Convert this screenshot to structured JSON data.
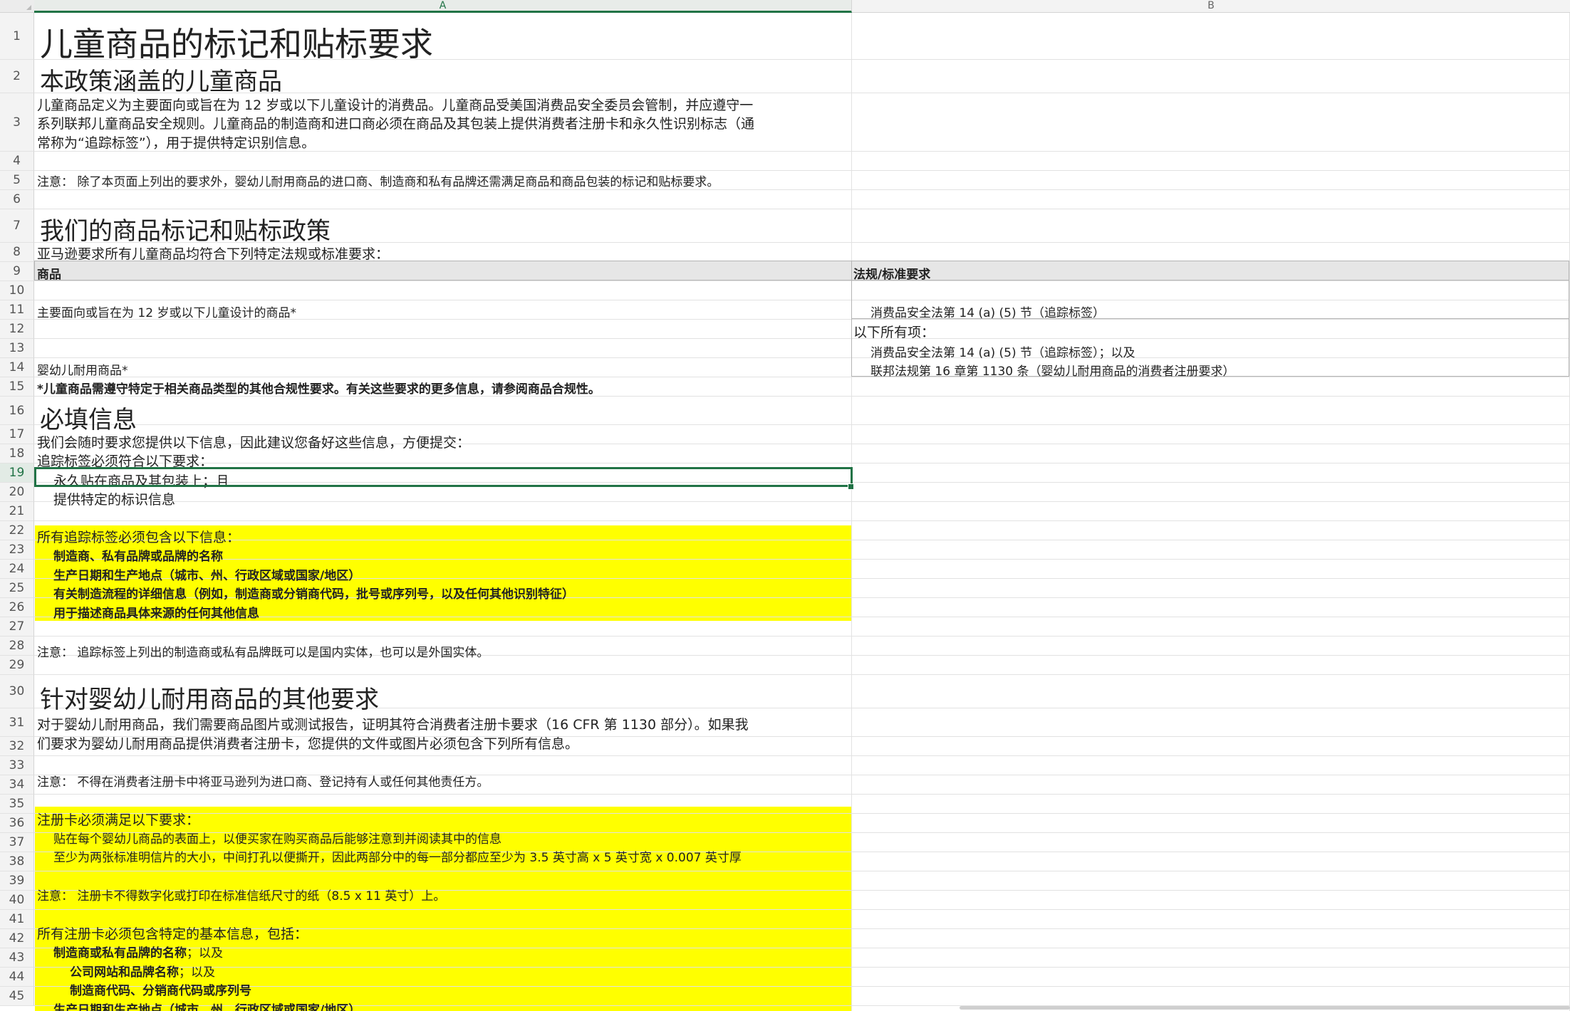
{
  "columns": [
    "A",
    "B"
  ],
  "rows": [
    "1",
    "2",
    "3",
    "4",
    "5",
    "6",
    "7",
    "8",
    "9",
    "10",
    "11",
    "12",
    "13",
    "14",
    "15",
    "16",
    "17",
    "18",
    "19",
    "20",
    "21",
    "22",
    "23",
    "24",
    "25",
    "26",
    "27",
    "28",
    "29",
    "30",
    "31",
    "32",
    "33",
    "34",
    "35",
    "36",
    "37",
    "38",
    "39",
    "40",
    "41",
    "42",
    "43",
    "44",
    "45"
  ],
  "selected_row": "19",
  "title": "儿童商品的标记和贴标要求",
  "section1": {
    "heading": "本政策涵盖的儿童商品",
    "para_line1": "儿童商品定义为主要面向或旨在为 12 岁或以下儿童设计的消费品。儿童商品受美国消费品安全委员会管制，并应遵守一",
    "para_line2": "系列联邦儿童商品安全规则。儿童商品的制造商和进口商必须在商品及其包装上提供消费者注册卡和永久性识别标志（通",
    "para_line3": "常称为“追踪标签”），用于提供特定识别信息。",
    "note": "注意：  除了本页面上列出的要求外，婴幼儿耐用商品的进口商、制造商和私有品牌还需满足商品和商品包装的标记和贴标要求。"
  },
  "section2": {
    "heading": "我们的商品标记和贴标政策",
    "intro": "亚马逊要求所有儿童商品均符合下列特定法规或标准要求：",
    "table_header_product": "商品",
    "table_header_reg": "法规/标准要求",
    "row1_product": "主要面向或旨在为 12 岁或以下儿童设计的商品*",
    "row1_reg": "消费品安全法第 14 (a) (5) 节（追踪标签）",
    "row2_product": "婴幼儿耐用商品*",
    "row2_reg_line1": "以下所有项：",
    "row2_reg_line2": "消费品安全法第 14 (a) (5) 节（追踪标签）；以及",
    "row2_reg_line3": "联邦法规第 16 章第 1130 条（婴幼儿耐用商品的消费者注册要求）",
    "footnote": "*儿童商品需遵守特定于相关商品类型的其他合规性要求。有关这些要求的更多信息，请参阅商品合规性。"
  },
  "section3": {
    "heading": "必填信息",
    "line17": "我们会随时要求您提供以下信息，因此建议您备好这些信息，方便提交：",
    "line18": "追踪标签必须符合以下要求：",
    "line19": "永久贴在商品及其包装上；且",
    "line20": "提供特定的标识信息",
    "line22": "所有追踪标签必须包含以下信息：",
    "line23": "制造商、私有品牌或品牌的名称",
    "line24": "生产日期和生产地点（城市、州、行政区域或国家/地区）",
    "line25": "有关制造流程的详细信息（例如，制造商或分销商代码，批号或序列号，以及任何其他识别特征）",
    "line26": "用于描述商品具体来源的任何其他信息",
    "line28": "注意：  追踪标签上列出的制造商或私有品牌既可以是国内实体，也可以是外国实体。"
  },
  "section4": {
    "heading": "针对婴幼儿耐用商品的其他要求",
    "line31a": "对于婴幼儿耐用商品，我们需要商品图片或测试报告，证明其符合消费者注册卡要求（16 CFR 第 1130 部分）。如果我",
    "line31b": "们要求为婴幼儿耐用商品提供消费者注册卡，您提供的文件或图片必须包含下列所有信息。",
    "line33": "注意：  不得在消费者注册卡中将亚马逊列为进口商、登记持有人或任何其他责任方。",
    "line35": "注册卡必须满足以下要求：",
    "line36": "贴在每个婴幼儿商品的表面上，以便买家在购买商品后能够注意到并阅读其中的信息",
    "line37": "至少为两张标准明信片的大小，中间打孔以便撕开，因此两部分中的每一部分都应至少为 3.5 英寸高 x 5 英寸宽 x 0.007 英寸厚",
    "line39": "注意：  注册卡不得数字化或打印在标准信纸尺寸的纸（8.5 x 11 英寸）上。",
    "line41": "所有注册卡必须包含特定的基本信息，包括：",
    "line42a": "制造商或私有品牌的名称",
    "line42b": "；以及",
    "line43a": "公司网站和品牌名称",
    "line43b": "；以及",
    "line44": "制造商代码、分销商代码或序列号",
    "line45": "生产日期和生产地点（城市、州、行政区域或国家/地区）"
  },
  "colors": {
    "highlight": "#ffff00",
    "selection": "#217346"
  }
}
